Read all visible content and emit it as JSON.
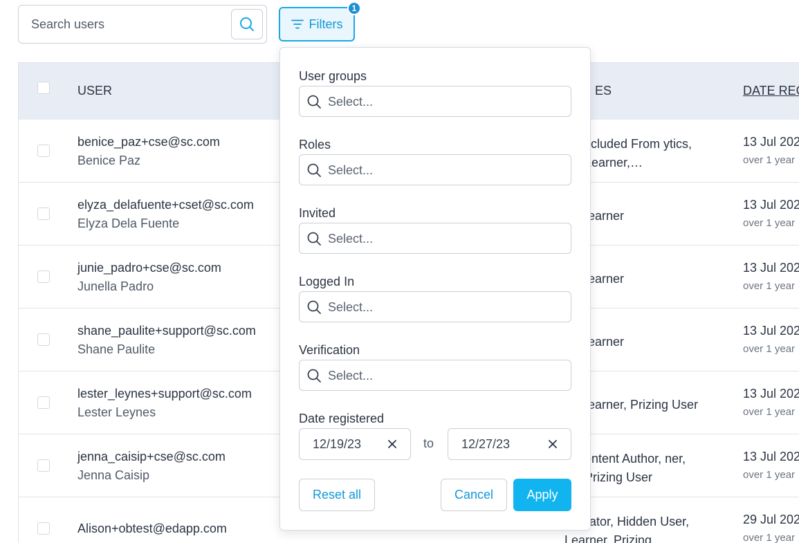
{
  "search": {
    "placeholder": "Search users"
  },
  "filters": {
    "label": "Filters",
    "badge": "1"
  },
  "table": {
    "headers": {
      "user": "USER",
      "roles": "ES",
      "date": "DATE REG"
    },
    "rows": [
      {
        "email": "benice_paz+cse@sc.com",
        "name": "Benice Paz",
        "roles": "xcluded From ytics, Learner,…",
        "date": "13 Jul 202",
        "ago": "over 1 year"
      },
      {
        "email": "elyza_delafuente+cset@sc.com",
        "name": "Elyza Dela Fuente",
        "roles": "earner",
        "date": "13 Jul 202",
        "ago": "over 1 year"
      },
      {
        "email": "junie_padro+cse@sc.com",
        "name": "Junella Padro",
        "roles": "earner",
        "date": "13 Jul 202",
        "ago": "over 1 year"
      },
      {
        "email": "shane_paulite+support@sc.com",
        "name": "Shane Paulite",
        "roles": "earner",
        "date": "13 Jul 202",
        "ago": "over 1 year"
      },
      {
        "email": "lester_leynes+support@sc.com",
        "name": "Lester Leynes",
        "roles": "earner, Prizing User",
        "date": "13 Jul 202",
        "ago": "over 1 year"
      },
      {
        "email": "jenna_caisip+cse@sc.com",
        "name": "Jenna Caisip",
        "roles": "ontent Author, ner, Prizing User",
        "date": "13 Jul 202",
        "ago": "over 1 year"
      },
      {
        "email": "Alison+obtest@edapp.com",
        "name": "",
        "roles": "acilitator, Hidden User, Learner, Prizing…",
        "date": "29 Jul 202",
        "ago": "over 1 year"
      }
    ]
  },
  "panel": {
    "user_groups": {
      "label": "User groups",
      "placeholder": "Select..."
    },
    "roles": {
      "label": "Roles",
      "placeholder": "Select..."
    },
    "invited": {
      "label": "Invited",
      "placeholder": "Select..."
    },
    "logged_in": {
      "label": "Logged In",
      "placeholder": "Select..."
    },
    "verification": {
      "label": "Verification",
      "placeholder": "Select..."
    },
    "date_registered": {
      "label": "Date registered",
      "from": "12/19/23",
      "to_label": "to",
      "to": "12/27/23"
    },
    "reset_label": "Reset all",
    "cancel_label": "Cancel",
    "apply_label": "Apply"
  },
  "colors": {
    "accent": "#12b4f0",
    "accent_text": "#1199d6",
    "header_bg": "#e8edf5"
  }
}
